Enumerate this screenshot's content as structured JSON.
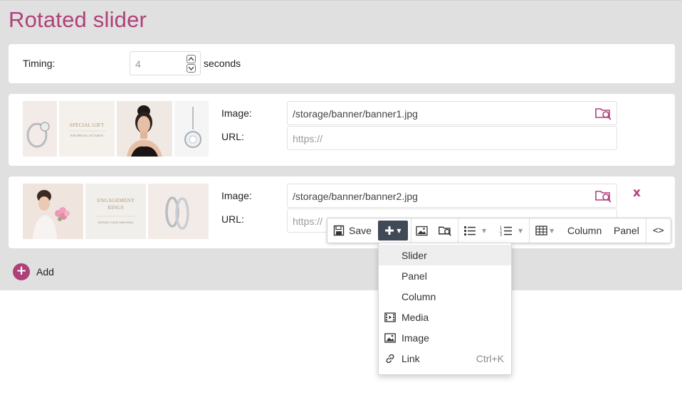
{
  "page": {
    "title": "Rotated slider"
  },
  "timing": {
    "label": "Timing:",
    "value": "4",
    "unit": "seconds"
  },
  "banners": [
    {
      "image_label": "Image:",
      "image_value": "/storage/banner/banner1.jpg",
      "url_label": "URL:",
      "url_placeholder": "https://",
      "thumb_texts": [
        "SPECIAL GIFT",
        "FOR SPECIAL OCCASION"
      ]
    },
    {
      "image_label": "Image:",
      "image_value": "/storage/banner/banner2.jpg",
      "url_label": "URL:",
      "url_placeholder": "https://",
      "remove_label": "x",
      "thumb_texts": [
        "ENGAGEMENT",
        "RINGS",
        "DESIGN YOUR OWN RING"
      ]
    }
  ],
  "add": {
    "label": "Add",
    "icon": "plus-icon"
  },
  "toolbar": {
    "save_label": "Save",
    "column_label": "Column",
    "panel_label": "Panel",
    "code_label": "<>"
  },
  "insert_menu": {
    "items": [
      {
        "label": "Slider",
        "icon": "",
        "shortcut": ""
      },
      {
        "label": "Panel",
        "icon": "",
        "shortcut": ""
      },
      {
        "label": "Column",
        "icon": "",
        "shortcut": ""
      },
      {
        "label": "Media",
        "icon": "film-icon",
        "shortcut": ""
      },
      {
        "label": "Image",
        "icon": "image-icon",
        "shortcut": ""
      },
      {
        "label": "Link",
        "icon": "link-icon",
        "shortcut": "Ctrl+K"
      }
    ]
  },
  "colors": {
    "accent": "#b0407a",
    "background": "#e0e0e0",
    "toolbar_active": "#3f4a56"
  }
}
